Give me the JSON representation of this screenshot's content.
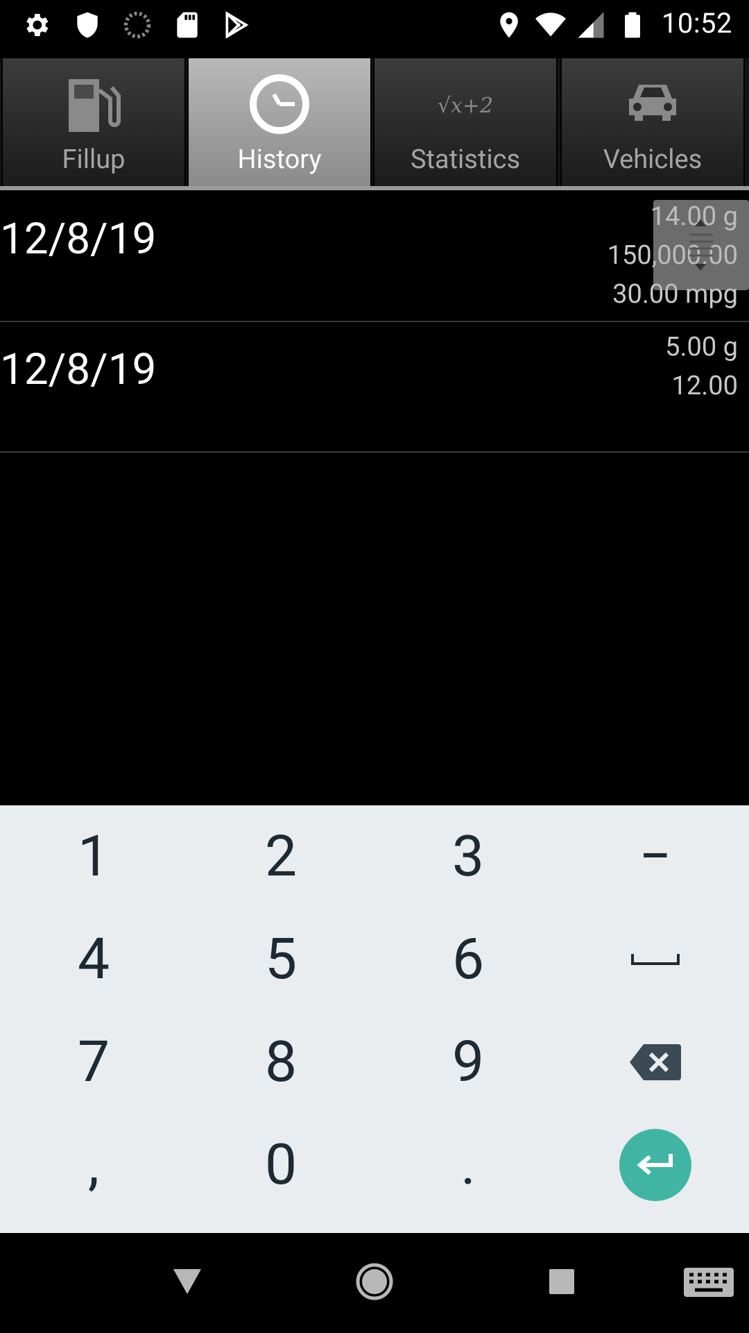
{
  "status_bar": {
    "time": "10:52",
    "left_icons": [
      "settings-icon",
      "shield-icon",
      "sync-icon",
      "sd-card-icon",
      "play-store-icon"
    ],
    "right_icons": [
      "location-icon",
      "wifi-icon",
      "signal-icon",
      "battery-icon"
    ]
  },
  "tabs": [
    {
      "label": "Fillup",
      "icon": "gas-pump-icon",
      "active": false
    },
    {
      "label": "History",
      "icon": "clock-icon",
      "active": true
    },
    {
      "label": "Statistics",
      "icon": "sqrt-formula-icon",
      "active": false
    },
    {
      "label": "Vehicles",
      "icon": "car-icon",
      "active": false
    }
  ],
  "statistics_icon_text": "√x+2",
  "history": [
    {
      "date": "12/8/19",
      "gallons": "14.00 g",
      "odometer": "150,000.00",
      "mpg": "30.00 mpg"
    },
    {
      "date": "12/8/19",
      "gallons": "5.00 g",
      "odometer": "12.00",
      "mpg": ""
    }
  ],
  "keyboard": {
    "rows": [
      [
        "1",
        "2",
        "3",
        "−"
      ],
      [
        "4",
        "5",
        "6",
        "space"
      ],
      [
        "7",
        "8",
        "9",
        "backspace"
      ],
      [
        ",",
        "0",
        ".",
        "enter"
      ]
    ]
  },
  "nav_bar": [
    "back-icon",
    "home-icon",
    "recents-icon",
    "keyboard-icon"
  ],
  "colors": {
    "enter_key": "#40b5a3",
    "keyboard_bg": "#e9edf0",
    "key_text": "#1d2a33"
  }
}
